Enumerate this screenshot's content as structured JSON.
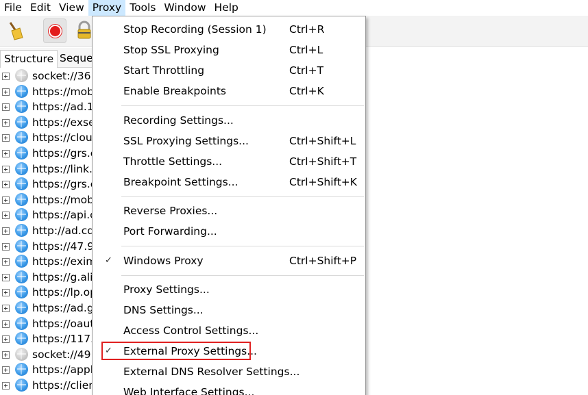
{
  "menubar": {
    "items": [
      "File",
      "Edit",
      "View",
      "Proxy",
      "Tools",
      "Window",
      "Help"
    ],
    "active": "Proxy"
  },
  "toolbar": {
    "buttons": [
      {
        "icon": "broom-icon"
      },
      {
        "icon": "record-icon",
        "state": "recording"
      },
      {
        "icon": "lock-icon"
      }
    ]
  },
  "tabs": [
    "Structure",
    "Seque"
  ],
  "tree": {
    "rows": [
      {
        "host": "socket://36.",
        "icon": "socket-globe-icon"
      },
      {
        "host": "https://mob",
        "icon": "globe-icon"
      },
      {
        "host": "https://ad.1",
        "icon": "globe-icon"
      },
      {
        "host": "https://exse",
        "icon": "globe-icon"
      },
      {
        "host": "https://clou",
        "icon": "globe-icon"
      },
      {
        "host": "https://grs.c",
        "icon": "globe-icon"
      },
      {
        "host": "https://link.",
        "icon": "globe-icon"
      },
      {
        "host": "https://grs.c",
        "icon": "globe-icon"
      },
      {
        "host": "https://mob",
        "icon": "globe-icon"
      },
      {
        "host": "https://api.c",
        "icon": "globe-icon"
      },
      {
        "host": "http://ad.cd",
        "icon": "globe-icon"
      },
      {
        "host": "https://47.9",
        "icon": "globe-icon"
      },
      {
        "host": "https://exim",
        "icon": "globe-icon"
      },
      {
        "host": "https://g.ali",
        "icon": "globe-icon"
      },
      {
        "host": "https://lp.op",
        "icon": "globe-icon"
      },
      {
        "host": "https://ad.g",
        "icon": "globe-icon"
      },
      {
        "host": "https://oaut",
        "icon": "globe-icon"
      },
      {
        "host": "https://117.",
        "icon": "globe-icon"
      },
      {
        "host": "socket://49.",
        "icon": "socket-globe-icon"
      },
      {
        "host": "https://appl",
        "icon": "globe-icon"
      },
      {
        "host": "https://clien",
        "icon": "globe-icon"
      }
    ]
  },
  "proxy_menu": {
    "groups": [
      [
        {
          "label": "Stop Recording (Session 1)",
          "shortcut": "Ctrl+R"
        },
        {
          "label": "Stop SSL Proxying",
          "shortcut": "Ctrl+L"
        },
        {
          "label": "Start Throttling",
          "shortcut": "Ctrl+T"
        },
        {
          "label": "Enable Breakpoints",
          "shortcut": "Ctrl+K"
        }
      ],
      [
        {
          "label": "Recording Settings...",
          "shortcut": ""
        },
        {
          "label": "SSL Proxying Settings...",
          "shortcut": "Ctrl+Shift+L"
        },
        {
          "label": "Throttle Settings...",
          "shortcut": "Ctrl+Shift+T"
        },
        {
          "label": "Breakpoint Settings...",
          "shortcut": "Ctrl+Shift+K"
        }
      ],
      [
        {
          "label": "Reverse Proxies...",
          "shortcut": ""
        },
        {
          "label": "Port Forwarding...",
          "shortcut": ""
        }
      ],
      [
        {
          "label": "Windows Proxy",
          "shortcut": "Ctrl+Shift+P",
          "checked": true
        }
      ],
      [
        {
          "label": "Proxy Settings...",
          "shortcut": ""
        },
        {
          "label": "DNS Settings...",
          "shortcut": ""
        },
        {
          "label": "Access Control Settings...",
          "shortcut": ""
        },
        {
          "label": "External Proxy Settings...",
          "shortcut": "",
          "checked": true,
          "highlighted": true
        },
        {
          "label": "External DNS Resolver Settings...",
          "shortcut": ""
        },
        {
          "label": "Web Interface Settings...",
          "shortcut": ""
        }
      ]
    ],
    "check_glyph": "✓",
    "highlight_color": "#e02020"
  }
}
